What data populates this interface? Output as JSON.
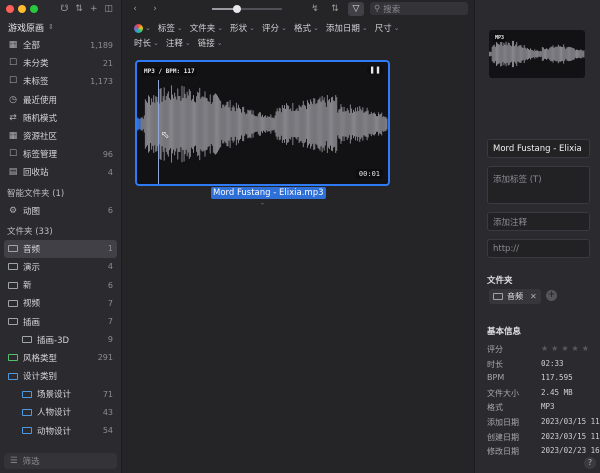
{
  "sidebar": {
    "library_title": "游戏原画",
    "items": [
      {
        "label": "全部",
        "count": "1,189",
        "icon": "grid-icon"
      },
      {
        "label": "未分类",
        "count": "21",
        "icon": "uncategorized-icon"
      },
      {
        "label": "未标签",
        "count": "1,173",
        "icon": "untagged-icon"
      },
      {
        "label": "最近使用",
        "count": "",
        "icon": "clock-icon"
      },
      {
        "label": "随机模式",
        "count": "",
        "icon": "shuffle-icon"
      },
      {
        "label": "资源社区",
        "count": "",
        "icon": "community-icon"
      },
      {
        "label": "标签管理",
        "count": "96",
        "icon": "tag-icon"
      },
      {
        "label": "回收站",
        "count": "4",
        "icon": "trash-icon"
      }
    ],
    "smart_folders_title": "智能文件夹 (1)",
    "smart_folders": [
      {
        "label": "动图",
        "count": "6"
      }
    ],
    "folders_title": "文件夹 (33)",
    "folders": [
      {
        "label": "音频",
        "count": "1",
        "active": true
      },
      {
        "label": "演示",
        "count": "4"
      },
      {
        "label": "新",
        "count": "6"
      },
      {
        "label": "视频",
        "count": "7"
      },
      {
        "label": "插画",
        "count": "7"
      },
      {
        "label": "插画-3D",
        "count": "9"
      },
      {
        "label": "风格类型",
        "count": "291"
      },
      {
        "label": "设计类别",
        "count": ""
      },
      {
        "label": "场景设计",
        "count": "71"
      },
      {
        "label": "人物设计",
        "count": "43"
      },
      {
        "label": "动物设计",
        "count": "54"
      }
    ],
    "filter_placeholder": "筛选"
  },
  "toolbar": {
    "zoom_fraction": 0.35,
    "search_placeholder": "搜索"
  },
  "filters": [
    "标签",
    "文件夹",
    "形状",
    "评分",
    "格式",
    "添加日期",
    "尺寸",
    "时长",
    "注释",
    "链接"
  ],
  "item": {
    "badge": "MP3 / BPM: 117",
    "duration": "00:01",
    "filename": "Mord Fustang - Elixia.mp3",
    "subtitle": "-"
  },
  "inspector": {
    "thumb_badge": "MP3",
    "title": "Mord Fustang - Elixia",
    "tags_placeholder": "添加标签 (T)",
    "note_placeholder": "添加注释",
    "url_placeholder": "http://",
    "folder_label": "文件夹",
    "folder_chip": "音频",
    "info_label": "基本信息",
    "info": [
      {
        "k": "评分",
        "v": ""
      },
      {
        "k": "时长",
        "v": "02:33"
      },
      {
        "k": "BPM",
        "v": "117.595"
      },
      {
        "k": "文件大小",
        "v": "2.45 MB"
      },
      {
        "k": "格式",
        "v": "MP3"
      },
      {
        "k": "添加日期",
        "v": "2023/03/15 11"
      },
      {
        "k": "创建日期",
        "v": "2023/03/15 11"
      },
      {
        "k": "修改日期",
        "v": "2023/02/23 16"
      }
    ]
  },
  "colors": {
    "accent": "#2f7bf5",
    "folder_blue": "#4d9ae0",
    "folder_green": "#4fc16a",
    "waveform": "#8c8c92",
    "waveform_played": "#3b7de8"
  }
}
